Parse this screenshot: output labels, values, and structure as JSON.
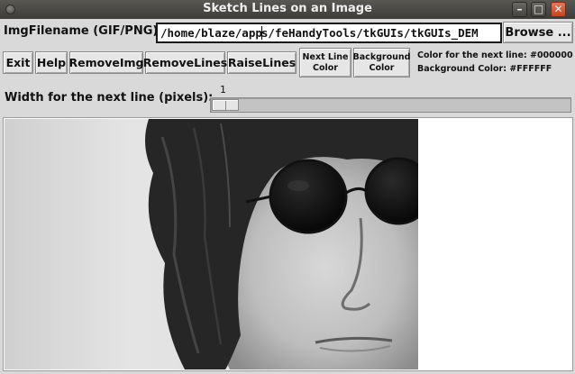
{
  "window": {
    "title": "Sketch Lines on an Image"
  },
  "file": {
    "label": "ImgFilename (GIF/PNG):",
    "value_before_caret": "/home/blaze/app",
    "value_after_caret": "s/feHandyTools/tkGUIs/tkGUIs_DEM",
    "browse_label": "Browse ..."
  },
  "buttons": {
    "exit": "Exit",
    "help": "Help",
    "remove_img": "RemoveImg",
    "remove_lines": "RemoveLines",
    "raise_lines": "RaiseLines",
    "next_line_color_1": "Next Line",
    "next_line_color_2": "Color",
    "background_color_1": "Background",
    "background_color_2": "Color"
  },
  "color_info": {
    "next_line": "Color for the next line:  #000000",
    "background": "Background Color:  #FFFFFF"
  },
  "width_scale": {
    "label": "Width for the next line (pixels):",
    "value": "1",
    "fraction": 0.0
  },
  "colors": {
    "window_bg": "#d9d9d9",
    "titlebar": "#3d3c38",
    "canvas_bg": "#ffffff",
    "next_line_color": "#000000"
  },
  "icons": {
    "window_menu": "circle-button-icon",
    "minimize": "minimize-icon",
    "maximize": "maximize-icon",
    "close": "close-icon"
  }
}
